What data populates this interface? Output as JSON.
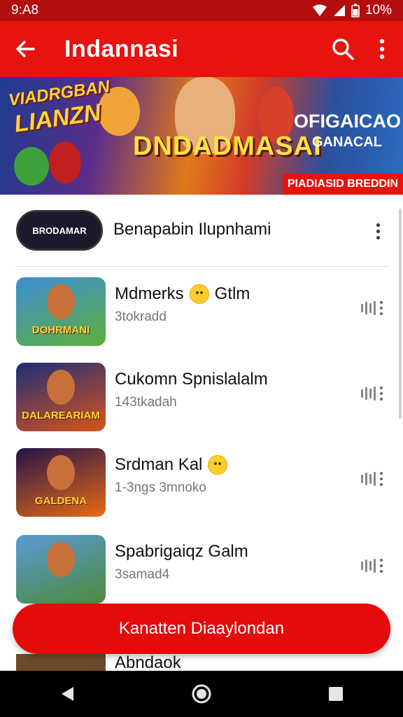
{
  "status_bar": {
    "time": "9:A8",
    "battery": "10%"
  },
  "app_bar": {
    "title": "Indannasi"
  },
  "banner": {
    "left_line1": "VIADRGBAN",
    "left_line2": "LIANZN",
    "main_title": "DNDADMASAI",
    "right_line1": "OFIGAICAO",
    "right_line2": "GANACAL",
    "tag": "PIADIASID BREDDIN"
  },
  "featured": {
    "badge": "BRODAMAR",
    "title": "Benapabin Ilupnhami"
  },
  "games": [
    {
      "title": "Mdmerks",
      "suffix": "Gtlm",
      "emoji": true,
      "subtitle": "3tokradd",
      "thumb_text": "DOHRMANI",
      "colors": [
        "#3c8fd6",
        "#5fae3a"
      ]
    },
    {
      "title": "Cukomn Spnislalalm",
      "suffix": "",
      "emoji": false,
      "subtitle": "143tkadah",
      "thumb_text": "DALAREARIAM",
      "colors": [
        "#1d2d78",
        "#d9541a"
      ]
    },
    {
      "title": "Srdman Kal",
      "suffix": "",
      "emoji": true,
      "subtitle": "1-3ngs 3mnoko",
      "thumb_text": "GALDENA",
      "colors": [
        "#24144a",
        "#e86a14"
      ]
    },
    {
      "title": "Spabrigaiqz Galm",
      "suffix": "",
      "emoji": false,
      "subtitle": "3samad4",
      "thumb_text": "",
      "colors": [
        "#5a9ad6",
        "#4c8a3a"
      ]
    }
  ],
  "peek_item": {
    "title": "Abndaok"
  },
  "cta": {
    "label": "Kanatten Diaaylondan"
  }
}
